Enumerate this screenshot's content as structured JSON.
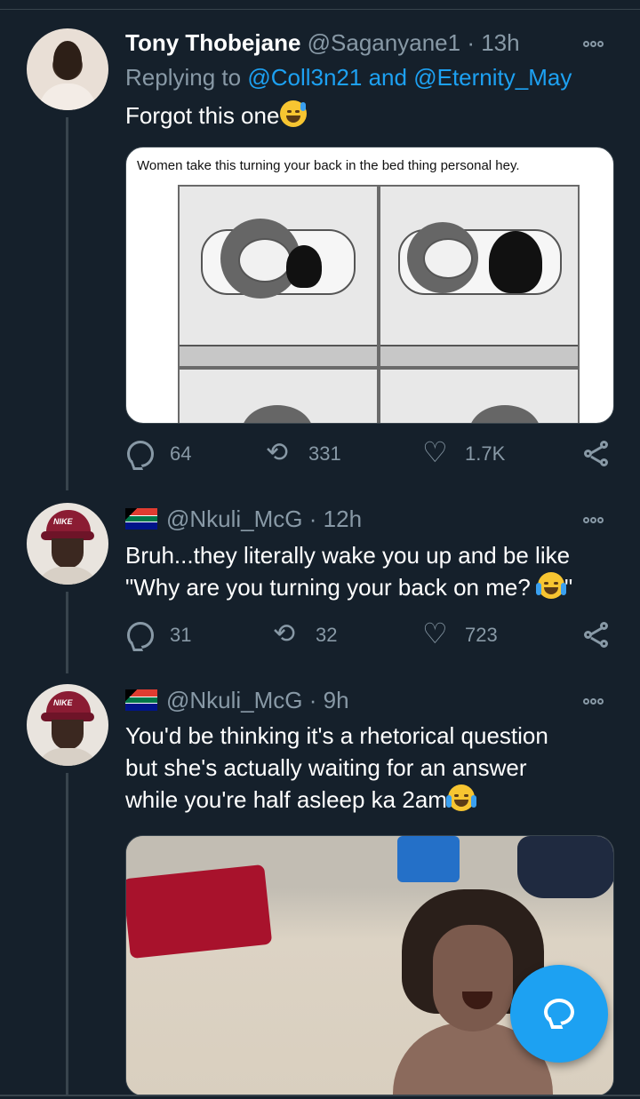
{
  "tweets": [
    {
      "name": "Tony Thobejane",
      "handle": "@Saganyane1",
      "time": "· 13h",
      "replying_prefix": "Replying to",
      "replying_user1": "@Coll3n21",
      "replying_and": "and",
      "replying_user2": "@Eternity_May",
      "text": "Forgot this one",
      "emoji": "sweat-smile-emoji",
      "image_caption": "Women take this turning your back in the bed thing personal hey.",
      "replies": "64",
      "retweets": "331",
      "likes": "1.7K"
    },
    {
      "handle": "@Nkuli_McG",
      "time": "· 12h",
      "flag": "south-africa-flag",
      "text_line1": "Bruh...they literally wake you up and be like",
      "text_line2_a": "\"Why are you turning your back on me?",
      "text_line2_b": "\"",
      "emoji": "tears-of-joy-emoji",
      "replies": "31",
      "retweets": "32",
      "likes": "723"
    },
    {
      "handle": "@Nkuli_McG",
      "time": "· 9h",
      "flag": "south-africa-flag",
      "text_line1": "You'd be thinking it's a rhetorical question",
      "text_line2": "but she's actually waiting for an answer",
      "text_line3": "while you're half asleep ka 2am",
      "emoji": "tears-of-joy-emoji"
    }
  ],
  "colors": {
    "background": "#15202b",
    "muted": "#8899a6",
    "link": "#1da1f2",
    "divider": "#38444d"
  }
}
